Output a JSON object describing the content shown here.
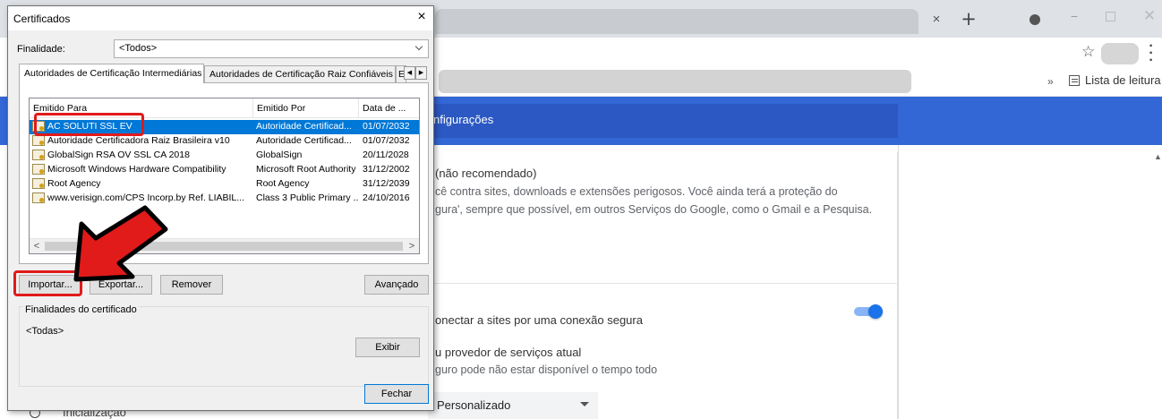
{
  "browser": {
    "tab_close": "×",
    "new_tab": "+",
    "window_min": "−",
    "window_close": "✕",
    "bookmark_star": "☆",
    "bookmarks_more": "»",
    "reading_list": "Lista de leitura",
    "search_settings_fragment": "nfigurações",
    "section1_title": "(não recomendado)",
    "section1_desc_line1": "cê contra sites, downloads e extensões perigosos. Você ainda terá a proteção do",
    "section1_desc_line2": "gura', sempre que possível, em outros Serviços do Google, como o Gmail e a Pesquisa.",
    "secure_connection": "onectar a sites por uma conexão segura",
    "provider_title": "u provedor de serviços atual",
    "provider_desc": "guro pode não estar disponível o tempo todo",
    "custom_select": "Personalizado",
    "left_bottom_item": "Inicialização",
    "secure_toggle_on": true
  },
  "dialog": {
    "title": "Certificados",
    "close": "×",
    "purpose_label": "Finalidade:",
    "purpose_value": "<Todos>",
    "tabs": [
      {
        "label": "Autoridades de Certificação Intermediárias",
        "active": true
      },
      {
        "label": "Autoridades de Certificação Raiz Confiáveis",
        "active": false
      },
      {
        "label": "E",
        "active": false
      }
    ],
    "tab_scroll_left": "◀",
    "tab_scroll_right": "▶",
    "columns": [
      "Emitido Para",
      "Emitido Por",
      "Data de ..."
    ],
    "rows": [
      {
        "issued_to": "AC SOLUTI SSL EV",
        "issued_by": "Autoridade Certificad...",
        "date": "01/07/2032",
        "selected": true
      },
      {
        "issued_to": "Autoridade Certificadora Raiz Brasileira v10",
        "issued_by": "Autoridade Certificad...",
        "date": "01/07/2032",
        "selected": false
      },
      {
        "issued_to": "GlobalSign RSA OV SSL CA 2018",
        "issued_by": "GlobalSign",
        "date": "20/11/2028",
        "selected": false
      },
      {
        "issued_to": "Microsoft Windows Hardware Compatibility",
        "issued_by": "Microsoft Root Authority",
        "date": "31/12/2002",
        "selected": false
      },
      {
        "issued_to": "Root Agency",
        "issued_by": "Root Agency",
        "date": "31/12/2039",
        "selected": false
      },
      {
        "issued_to": "www.verisign.com/CPS Incorp.by Ref. LIABIL...",
        "issued_by": "Class 3 Public Primary ...",
        "date": "24/10/2016",
        "selected": false
      }
    ],
    "scroll_left": "<",
    "scroll_right": ">",
    "buttons": {
      "import": "Importar...",
      "export": "Exportar...",
      "remove": "Remover",
      "advanced": "Avançado",
      "view": "Exibir",
      "close": "Fechar"
    },
    "purposes_group_title": "Finalidades do certificado",
    "purposes_group_value": "<Todas>"
  },
  "annotations": {
    "highlight_color": "#e11a1a",
    "highlighted": [
      "AC SOLUTI SSL EV",
      "Importar..."
    ]
  }
}
